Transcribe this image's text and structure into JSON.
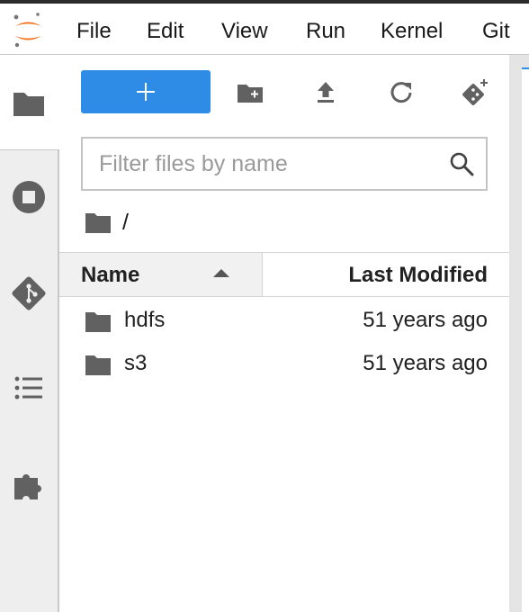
{
  "menu": {
    "items": [
      "File",
      "Edit",
      "View",
      "Run",
      "Kernel",
      "Git"
    ]
  },
  "sidebar": {
    "tabs": [
      {
        "icon": "folder-icon",
        "active": true
      },
      {
        "icon": "stop-circle-icon",
        "active": false
      },
      {
        "icon": "git-icon",
        "active": false
      },
      {
        "icon": "list-icon",
        "active": false
      },
      {
        "icon": "puzzle-icon",
        "active": false
      }
    ]
  },
  "toolbar": {
    "new_label": "+",
    "icons": [
      "new-folder-icon",
      "upload-icon",
      "refresh-icon",
      "git-clone-icon"
    ]
  },
  "filter": {
    "placeholder": "Filter files by name",
    "value": ""
  },
  "breadcrumb": {
    "path": "/"
  },
  "table": {
    "columns": {
      "name": "Name",
      "modified": "Last Modified"
    },
    "rows": [
      {
        "name": "hdfs",
        "modified": "51 years ago",
        "icon": "folder-icon"
      },
      {
        "name": "s3",
        "modified": "51 years ago",
        "icon": "folder-icon"
      }
    ]
  },
  "colors": {
    "accent": "#2f8ce6",
    "logo_orange": "#f37726",
    "icon": "#616161"
  }
}
